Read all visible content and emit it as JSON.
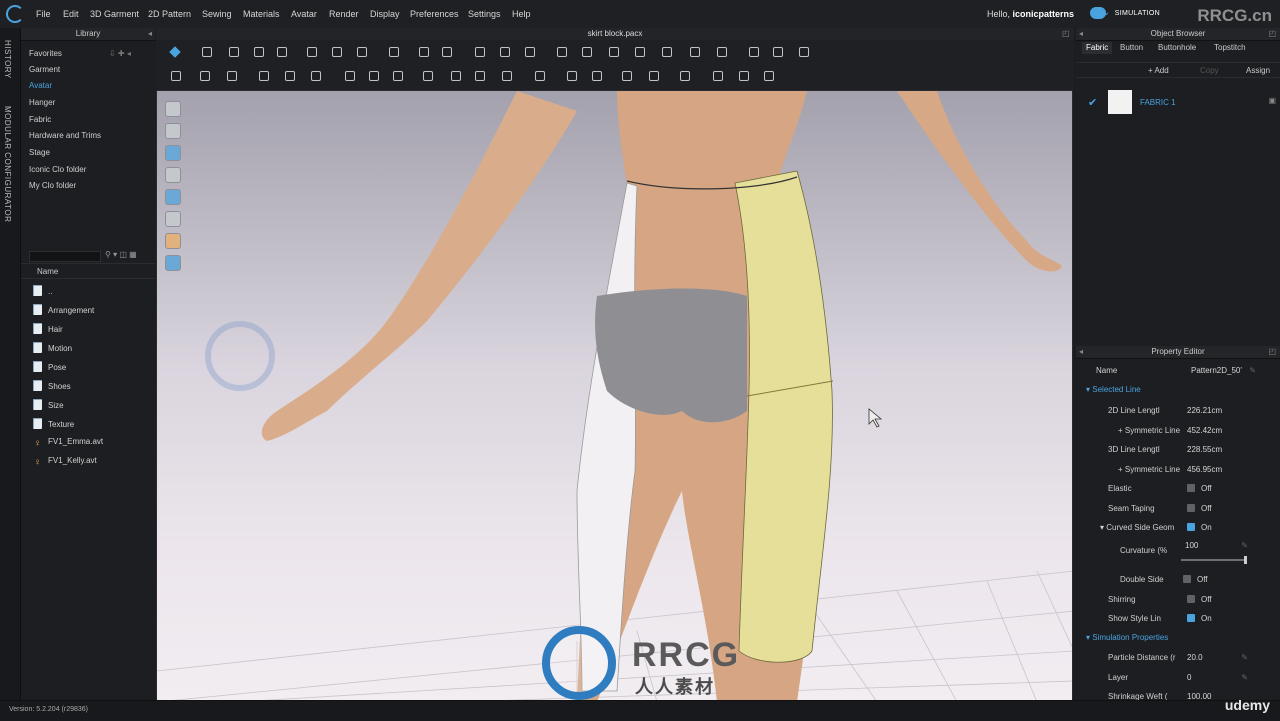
{
  "app": {
    "logo": "clo-logo-icon"
  },
  "menu": [
    "File",
    "Edit",
    "3D Garment",
    "2D Pattern",
    "Sewing",
    "Materials",
    "Avatar",
    "Render",
    "Display",
    "Preferences",
    "Settings",
    "Help"
  ],
  "user": {
    "greeting": "Hello,",
    "name": "iconicpatterns",
    "mode": "SIMULATION"
  },
  "side_tabs": [
    "HISTORY",
    "MODULAR CONFIGURATOR"
  ],
  "library": {
    "title": "Library",
    "categories": [
      "Favorites",
      "Garment",
      "Avatar",
      "Hanger",
      "Fabric",
      "Hardware and Trims",
      "Stage",
      "Iconic Clo folder",
      "My Clo folder"
    ],
    "active_category": "Avatar",
    "column_header": "Name",
    "items": [
      {
        "label": "..",
        "type": "folder"
      },
      {
        "label": "Arrangement",
        "type": "folder"
      },
      {
        "label": "Hair",
        "type": "folder"
      },
      {
        "label": "Motion",
        "type": "folder"
      },
      {
        "label": "Pose",
        "type": "folder"
      },
      {
        "label": "Shoes",
        "type": "folder"
      },
      {
        "label": "Size",
        "type": "folder"
      },
      {
        "label": "Texture",
        "type": "folder"
      },
      {
        "label": "FV1_Emma.avt",
        "type": "avatar"
      },
      {
        "label": "FV1_Kelly.avt",
        "type": "avatar"
      }
    ]
  },
  "document": {
    "title": "skirt block.pacx"
  },
  "object_browser": {
    "title": "Object Browser",
    "tabs": [
      "Fabric",
      "Button",
      "Buttonhole",
      "Topstitch"
    ],
    "actions": [
      "+ Add",
      "Copy",
      "Assign"
    ],
    "fabric": {
      "name": "FABRIC 1",
      "swatch_color": "#f2f2f2"
    }
  },
  "property_editor": {
    "title": "Property Editor",
    "name_label": "Name",
    "name_value": "Pattern2D_50'",
    "section_selected_line": "Selected Line",
    "rows": [
      {
        "label": "2D Line Lengtl",
        "value": "226.21cm"
      },
      {
        "label": "+ Symmetric Line",
        "value": "452.42cm"
      },
      {
        "label": "3D Line Lengtl",
        "value": "228.55cm"
      },
      {
        "label": "+ Symmetric Line",
        "value": "456.95cm"
      }
    ],
    "toggles": [
      {
        "label": "Elastic",
        "value": "Off",
        "checked": false
      },
      {
        "label": "Seam Taping",
        "value": "Off",
        "checked": false
      },
      {
        "label": "▾ Curved Side Geom",
        "value": "On",
        "checked": true
      }
    ],
    "curvature": {
      "label": "Curvature (%",
      "value": "100"
    },
    "toggles2": [
      {
        "label": "Double Side",
        "value": "Off",
        "checked": false
      },
      {
        "label": "Shirring",
        "value": "Off",
        "checked": false
      },
      {
        "label": "Show Style Lin",
        "value": "On",
        "checked": true
      }
    ],
    "section_simulation": "Simulation Properties",
    "sim_rows": [
      {
        "label": "Particle Distance (r",
        "value": "20.0"
      },
      {
        "label": "Layer",
        "value": "0"
      },
      {
        "label": "Shrinkage Weft (",
        "value": "100.00"
      }
    ]
  },
  "status": {
    "version": "Version: 5.2.204 (r29836)"
  },
  "watermarks": {
    "top_right": "RRCG.cn",
    "center_brand": "RRCG",
    "center_sub": "人人素材",
    "udemy": "udemy"
  },
  "colors": {
    "accent": "#4aa3df",
    "skirt": "#e6df9a",
    "background": "#1b1d20"
  }
}
